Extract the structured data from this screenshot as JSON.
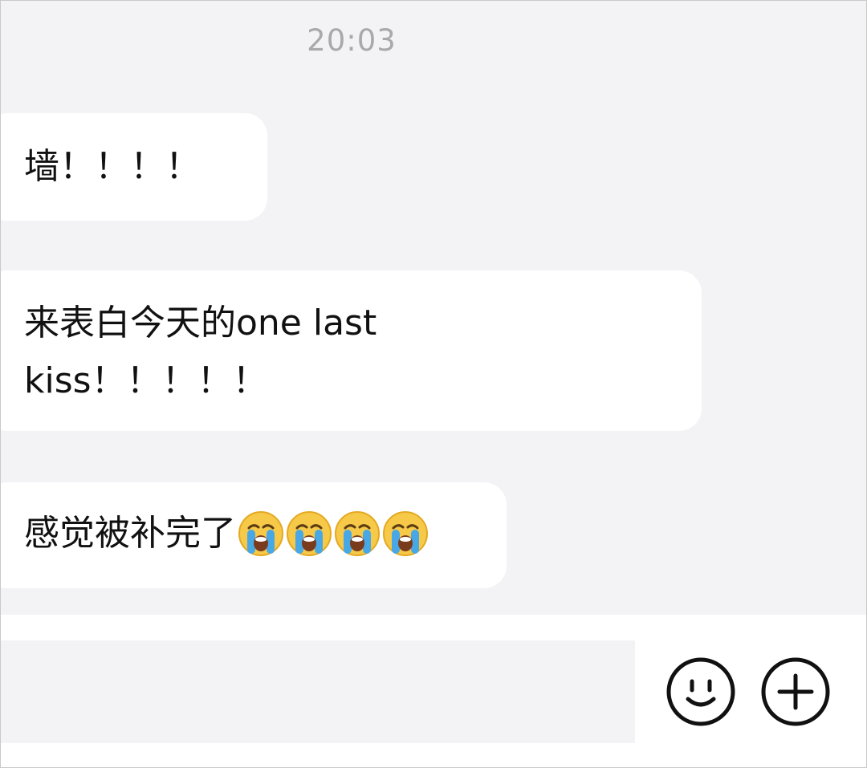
{
  "timestamp": "20:03",
  "messages": [
    {
      "text": "墙！！！！"
    },
    {
      "text": "来表白今天的one last\nkiss！！！！！"
    },
    {
      "text": "感觉被补完了",
      "emojis": [
        "loudly-crying-face",
        "loudly-crying-face",
        "loudly-crying-face",
        "loudly-crying-face"
      ]
    }
  ],
  "input": {
    "value": "",
    "placeholder": ""
  },
  "toolbar": {
    "emoji_icon": "smiley-face-icon",
    "plus_icon": "plus-circle-icon"
  },
  "colors": {
    "background": "#f3f2f5",
    "bubble": "#ffffff",
    "timestamp": "#a9a9ad",
    "icon_stroke": "#111111"
  }
}
